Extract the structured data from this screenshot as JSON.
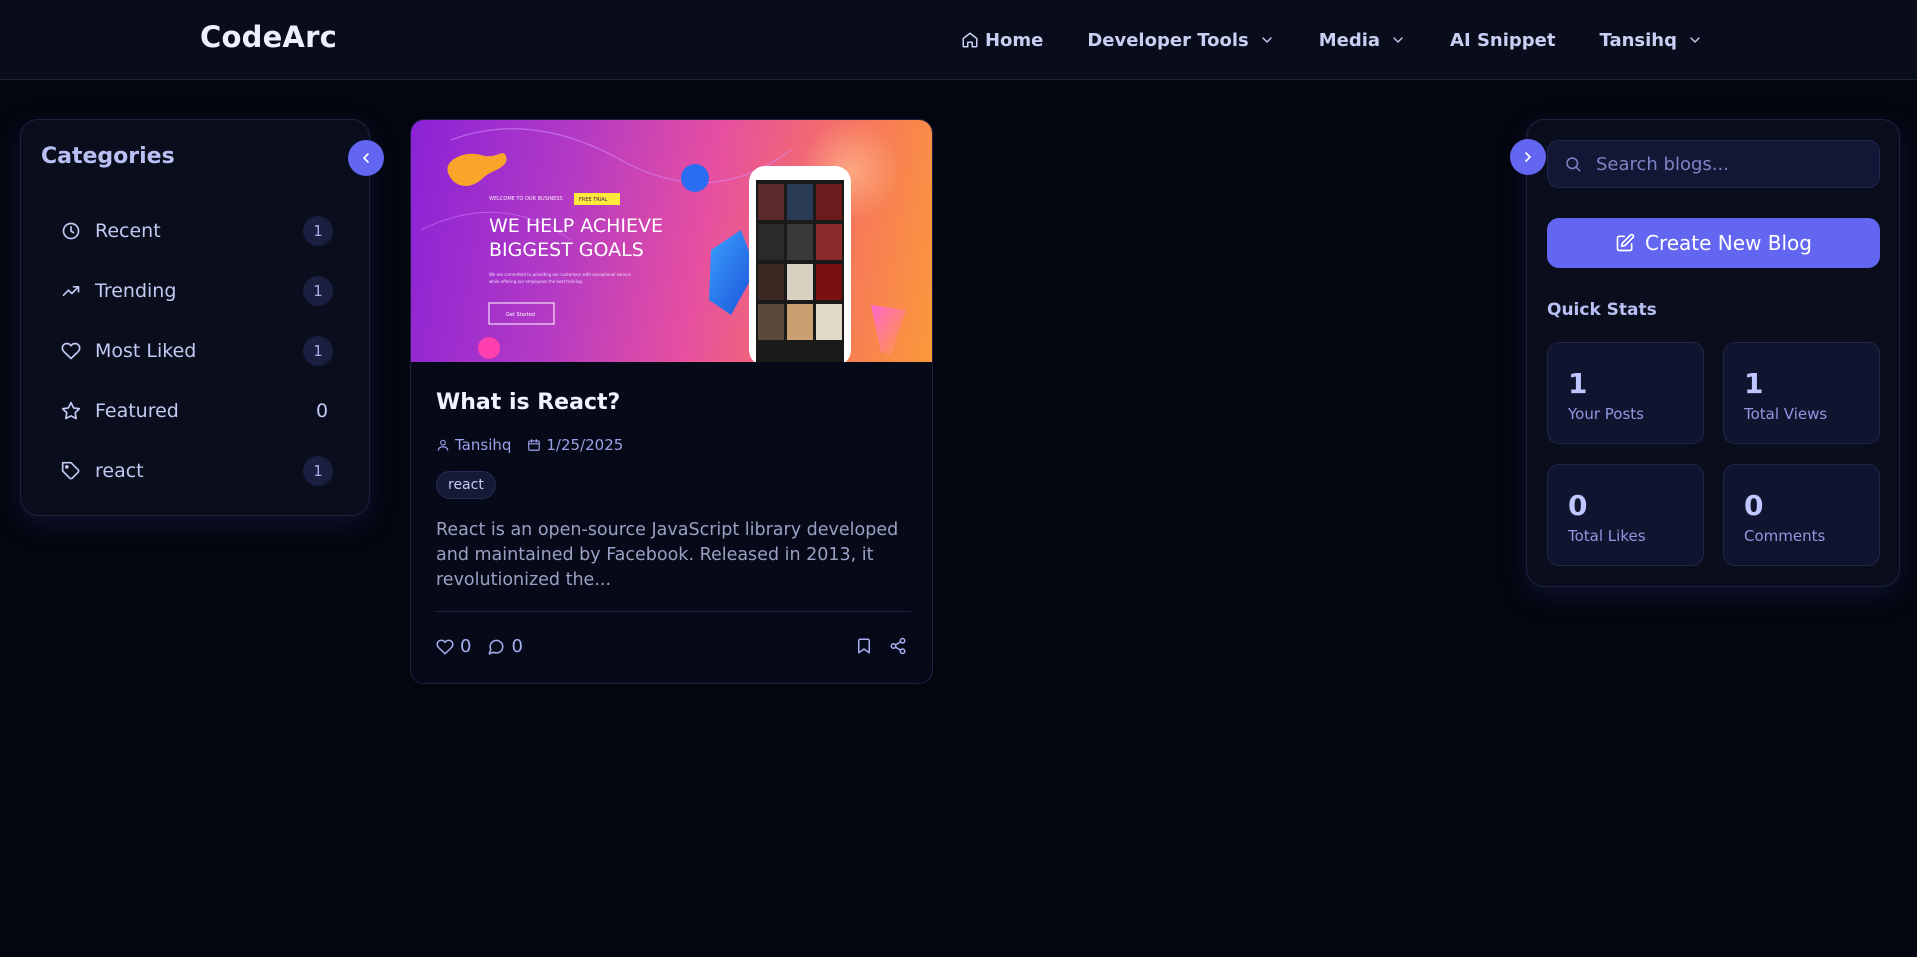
{
  "nav": {
    "logo": "CodeArc",
    "items": [
      {
        "label": "Home",
        "icon": "home-icon",
        "dropdown": false
      },
      {
        "label": "Developer Tools",
        "dropdown": true
      },
      {
        "label": "Media",
        "dropdown": true
      },
      {
        "label": "AI Snippet",
        "dropdown": false
      },
      {
        "label": "Tansihq",
        "dropdown": true
      }
    ]
  },
  "categories": {
    "title": "Categories",
    "items": [
      {
        "label": "Recent",
        "icon": "clock-icon",
        "count": "1"
      },
      {
        "label": "Trending",
        "icon": "trending-up-icon",
        "count": "1"
      },
      {
        "label": "Most Liked",
        "icon": "heart-icon",
        "count": "1"
      },
      {
        "label": "Featured",
        "icon": "star-icon",
        "count": "0"
      },
      {
        "label": "react",
        "icon": "tag-icon",
        "count": "1"
      }
    ]
  },
  "post": {
    "image": {
      "subheading_left": "WELCOME TO OUR BUSINESS",
      "badge": "FREE TRIAL",
      "headline_line1": "WE HELP ACHIEVE",
      "headline_line2": "BIGGEST GOALS",
      "body": "We are committed to providing our customers with exceptional service",
      "body2": "while offering our employees the best training.",
      "cta": "Get Started"
    },
    "title": "What is React?",
    "author": "Tansihq",
    "date": "1/25/2025",
    "tag": "react",
    "excerpt": "React is an open-source JavaScript library developed and maintained by Facebook. Released in 2013, it revolutionized the...",
    "likes": "0",
    "comments": "0"
  },
  "sidebar": {
    "search_placeholder": "Search blogs...",
    "create_label": "Create New Blog",
    "quick_stats_title": "Quick Stats",
    "stats": [
      {
        "value": "1",
        "label": "Your Posts"
      },
      {
        "value": "1",
        "label": "Total Views"
      },
      {
        "value": "0",
        "label": "Total Likes"
      },
      {
        "value": "0",
        "label": "Comments"
      }
    ]
  },
  "colors": {
    "accent": "#6366f1",
    "background": "#04060f",
    "card": "#090d1c"
  }
}
